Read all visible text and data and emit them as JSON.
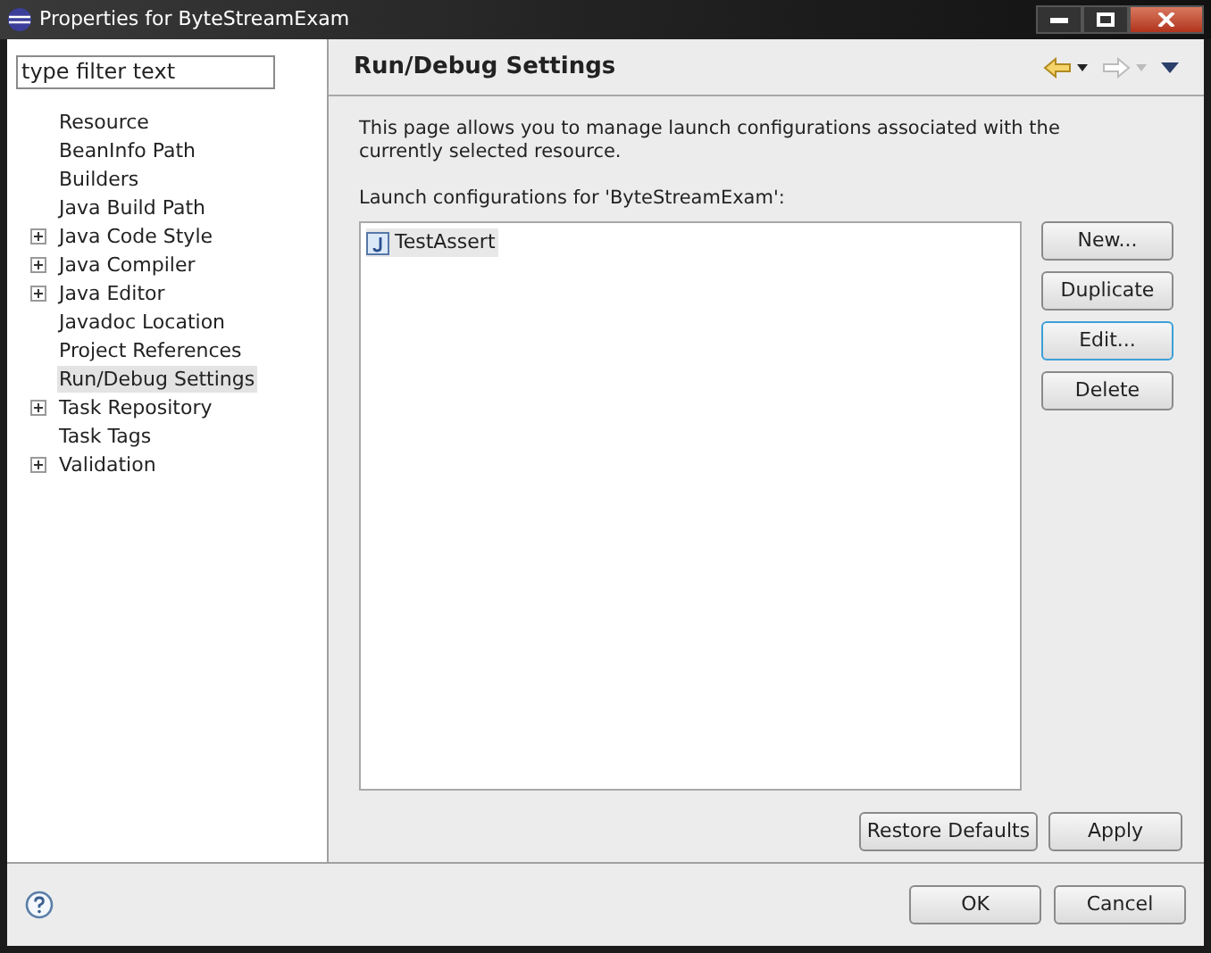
{
  "window": {
    "title": "Properties for ByteStreamExam"
  },
  "filter": {
    "placeholder": "type filter text"
  },
  "tree": [
    {
      "label": "Resource",
      "kind": "leaf",
      "selected": false
    },
    {
      "label": "BeanInfo Path",
      "kind": "leaf",
      "selected": false
    },
    {
      "label": "Builders",
      "kind": "leaf",
      "selected": false
    },
    {
      "label": "Java Build Path",
      "kind": "leaf",
      "selected": false
    },
    {
      "label": "Java Code Style",
      "kind": "folder",
      "expanded": false,
      "selected": false
    },
    {
      "label": "Java Compiler",
      "kind": "folder",
      "expanded": false,
      "selected": false
    },
    {
      "label": "Java Editor",
      "kind": "folder",
      "expanded": false,
      "selected": false
    },
    {
      "label": "Javadoc Location",
      "kind": "leaf",
      "selected": false
    },
    {
      "label": "Project References",
      "kind": "leaf",
      "selected": false
    },
    {
      "label": "Run/Debug Settings",
      "kind": "leaf",
      "selected": true
    },
    {
      "label": "Task Repository",
      "kind": "folder",
      "expanded": false,
      "selected": false
    },
    {
      "label": "Task Tags",
      "kind": "leaf",
      "selected": false
    },
    {
      "label": "Validation",
      "kind": "folder",
      "expanded": false,
      "selected": false
    }
  ],
  "page": {
    "title": "Run/Debug Settings",
    "description": "This page allows you to manage launch configurations associated with the currently selected resource.",
    "list_label": "Launch configurations for 'ByteStreamExam':",
    "configurations": [
      {
        "label": "TestAssert",
        "selected": true
      }
    ],
    "side_buttons": [
      {
        "label": "New...",
        "focused": false
      },
      {
        "label": "Duplicate",
        "focused": false
      },
      {
        "label": "Edit...",
        "focused": true
      },
      {
        "label": "Delete",
        "focused": false
      }
    ],
    "page_buttons": [
      "Restore Defaults",
      "Apply"
    ]
  },
  "dialog_buttons": [
    "OK",
    "Cancel"
  ]
}
